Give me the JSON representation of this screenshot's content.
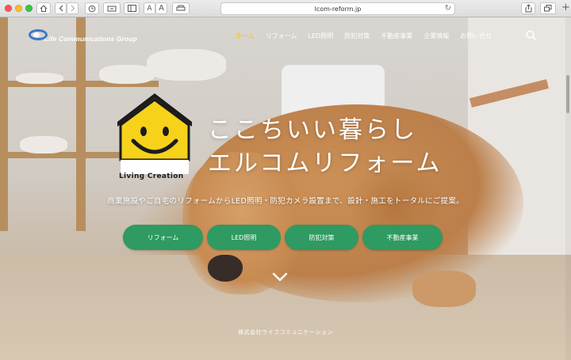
{
  "browser": {
    "url": "lcom-reform.jp",
    "text_smaller": "A",
    "text_larger": "A"
  },
  "site": {
    "logo_text": "Life Communications Group",
    "nav": [
      "ホーム",
      "リフォーム",
      "LED照明",
      "防犯対策",
      "不動産事業",
      "企業情報",
      "お問い合せ"
    ],
    "nav_active_index": 0,
    "house_label": "Living Creation",
    "headline_line1": "ここちいい暮らし",
    "headline_line2": "エルコムリフォーム",
    "tagline": "商業施設やご自宅のリフォームからLED照明・防犯カメラ設置まで、設計・施工をトータルにご提案。",
    "cta_buttons": [
      "リフォーム",
      "LED照明",
      "防犯対策",
      "不動産事業"
    ],
    "footer": "株式会社ライフコミュニケーション"
  },
  "colors": {
    "nav_active": "#f1c40f",
    "cta_green": "#2f9a62",
    "house_yellow": "#f6d21b",
    "house_roof": "#1c1c1c"
  },
  "icons": {
    "search": "search-icon",
    "scroll_down": "chevron-down-icon"
  }
}
